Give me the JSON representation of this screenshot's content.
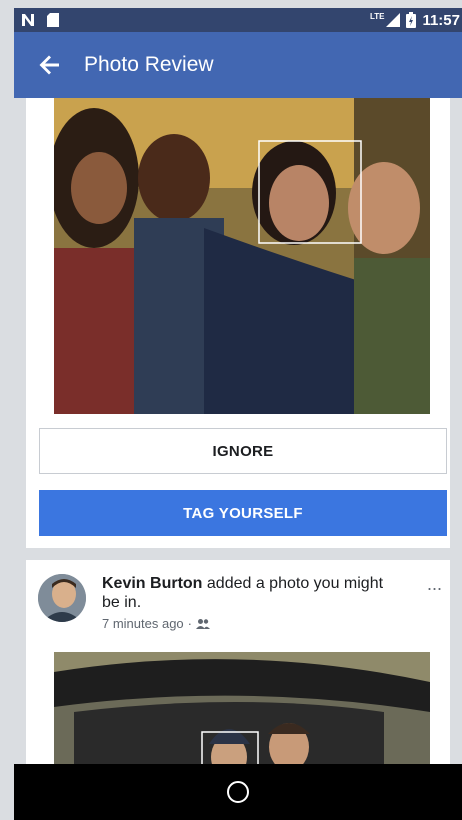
{
  "status_bar": {
    "network": "LTE",
    "time": "11:57"
  },
  "app_bar": {
    "title": "Photo Review"
  },
  "review_card": {
    "ignore_label": "IGNORE",
    "tag_label": "TAG YOURSELF"
  },
  "post": {
    "author": "Kevin Burton",
    "action": " added a photo you might be in.",
    "time": "7 minutes ago",
    "separator": "·",
    "more": "..."
  },
  "colors": {
    "app_bar": "#4267b2",
    "status_bar": "#33456e",
    "primary_button": "#3b76e0"
  }
}
